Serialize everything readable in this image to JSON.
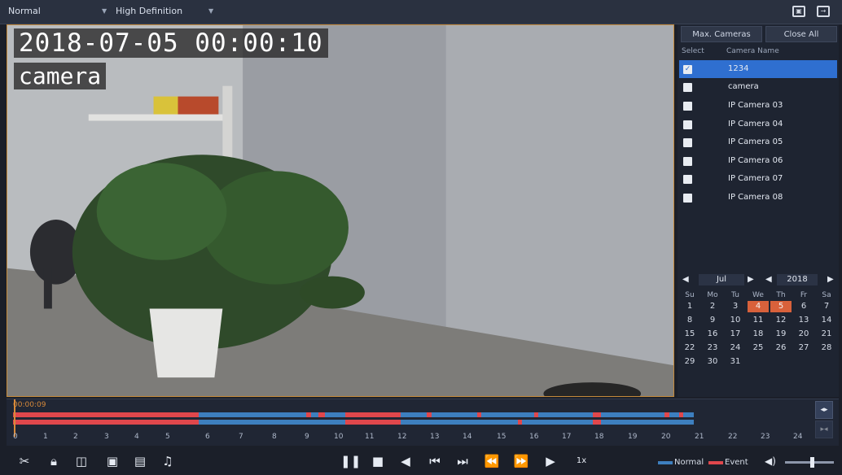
{
  "topbar": {
    "stream_mode": "Normal",
    "quality": "High Definition",
    "fullscreen_icon": "fullscreen-icon",
    "exit_icon": "exit-icon"
  },
  "video": {
    "timestamp": "2018-07-05 00:00:10",
    "camera_label": "camera"
  },
  "side": {
    "max_cameras_label": "Max. Cameras",
    "close_all_label": "Close All",
    "col_select": "Select",
    "col_camera_name": "Camera Name",
    "cameras": [
      {
        "name": "1234",
        "checked": true
      },
      {
        "name": "camera",
        "checked": false
      },
      {
        "name": "IP Camera 03",
        "checked": false
      },
      {
        "name": "IP Camera 04",
        "checked": false
      },
      {
        "name": "IP Camera 05",
        "checked": false
      },
      {
        "name": "IP Camera 06",
        "checked": false
      },
      {
        "name": "IP Camera 07",
        "checked": false
      },
      {
        "name": "IP Camera 08",
        "checked": false
      }
    ]
  },
  "calendar": {
    "month": "Jul",
    "year": "2018",
    "weekdays": [
      "Su",
      "Mo",
      "Tu",
      "We",
      "Th",
      "Fr",
      "Sa"
    ],
    "weeks": [
      [
        "1",
        "2",
        "3",
        "4",
        "5",
        "6",
        "7"
      ],
      [
        "8",
        "9",
        "10",
        "11",
        "12",
        "13",
        "14"
      ],
      [
        "15",
        "16",
        "17",
        "18",
        "19",
        "20",
        "21"
      ],
      [
        "22",
        "23",
        "24",
        "25",
        "26",
        "27",
        "28"
      ],
      [
        "29",
        "30",
        "31",
        "",
        "",
        "",
        ""
      ]
    ],
    "recorded_days": [
      "4",
      "5"
    ]
  },
  "timeline": {
    "current_time": "00:00:09",
    "hours": [
      "0",
      "1",
      "2",
      "3",
      "4",
      "5",
      "6",
      "7",
      "8",
      "9",
      "10",
      "11",
      "12",
      "13",
      "14",
      "15",
      "16",
      "17",
      "18",
      "19",
      "20",
      "21",
      "22",
      "23",
      "24"
    ],
    "colors": {
      "normal": "#3d7fbf",
      "event": "#e0474c"
    }
  },
  "bottom": {
    "speed": "1x",
    "legend_normal": "Normal",
    "legend_event": "Event",
    "volume_level": 0.55
  }
}
